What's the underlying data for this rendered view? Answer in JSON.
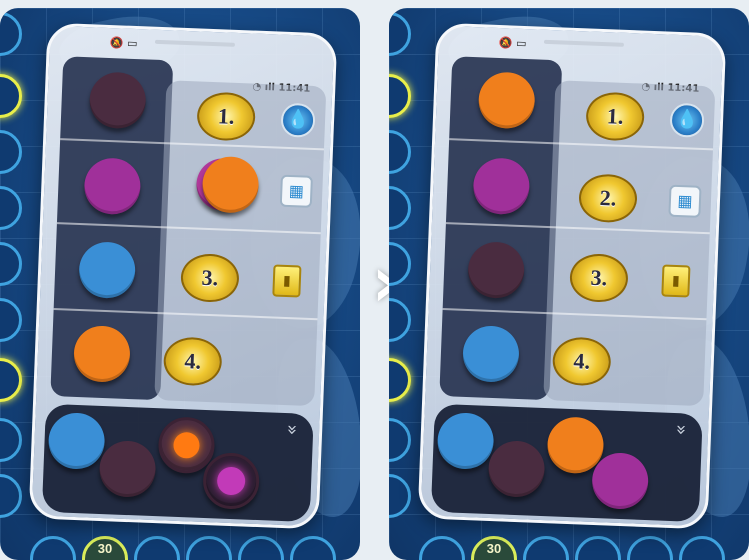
{
  "colors": {
    "orange": "#f07f1c",
    "purple": "#a0309a",
    "blue": "#3a8fd6",
    "dark": "#4a2c40",
    "glow_orange": "#ff8a1a",
    "glow_purple": "#d040c0"
  },
  "status": {
    "time": "11:41"
  },
  "ranks": [
    "1.",
    "2.",
    "3.",
    "4."
  ],
  "bottom_track": {
    "value": "30"
  },
  "transition_icon": "»",
  "before": {
    "left_column": [
      "dark",
      "purple",
      "blue",
      "orange"
    ],
    "right_column": [
      {
        "rank": "1.",
        "bonus": "water-drop-icon"
      },
      {
        "rank": "",
        "bonus": "tank-icon",
        "covered_by": "orange"
      },
      {
        "rank": "3.",
        "bonus": "chip-icon"
      },
      {
        "rank": "4.",
        "bonus": ""
      }
    ],
    "tray": [
      "blue",
      "dark",
      "orange",
      "purple"
    ],
    "tray_highlighted": [
      "orange",
      "purple"
    ]
  },
  "after": {
    "left_column": [
      "orange",
      "purple",
      "dark",
      "blue"
    ],
    "right_column": [
      {
        "rank": "1.",
        "bonus": "water-drop-icon"
      },
      {
        "rank": "2.",
        "bonus": "tank-icon"
      },
      {
        "rank": "3.",
        "bonus": "chip-icon"
      },
      {
        "rank": "4.",
        "bonus": ""
      }
    ],
    "tray": [
      "blue",
      "dark",
      "orange",
      "purple"
    ]
  }
}
